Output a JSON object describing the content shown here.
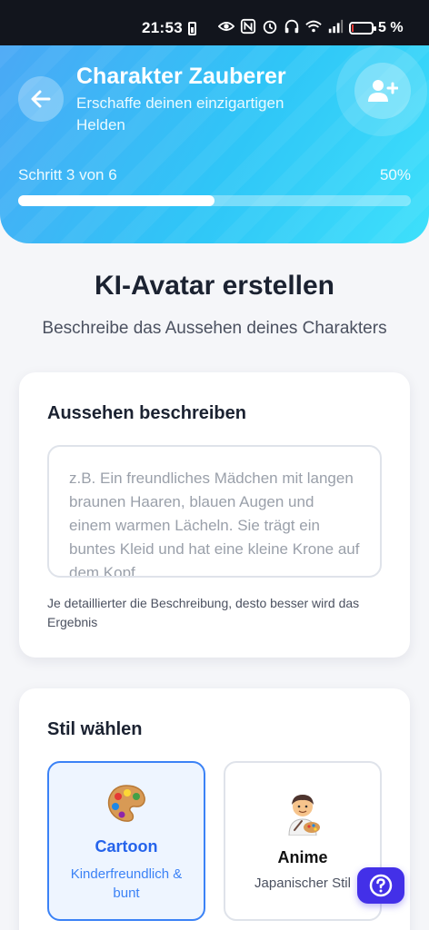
{
  "status_bar": {
    "time": "21:53",
    "battery_percent": "5 %"
  },
  "header": {
    "title": "Charakter Zauberer",
    "subtitle": "Erschaffe deinen einzigartigen Helden",
    "step_label": "Schritt 3 von 6",
    "progress_percent_label": "50%",
    "progress_fraction": 0.5
  },
  "main": {
    "title": "KI-Avatar erstellen",
    "subtitle": "Beschreibe das Aussehen deines Charakters"
  },
  "appearance_card": {
    "title": "Aussehen beschreiben",
    "placeholder": "z.B. Ein freundliches Mädchen mit langen braunen Haaren, blauen Augen und einem warmen Lächeln. Sie trägt ein buntes Kleid und hat eine kleine Krone auf dem Kopf...",
    "hint": "Je detaillierter die Beschreibung, desto besser wird das Ergebnis"
  },
  "style_card": {
    "title": "Stil wählen",
    "options": [
      {
        "name": "Cartoon",
        "description": "Kinderfreundlich & bunt",
        "icon": "palette-icon",
        "selected": true
      },
      {
        "name": "Anime",
        "description": "Japanischer Stil",
        "icon": "artist-icon",
        "selected": false
      }
    ]
  },
  "colors": {
    "accent": "#3b82f6",
    "help_button": "#4330e8",
    "header_start": "#4aa8f5",
    "header_end": "#3ee0fb"
  }
}
